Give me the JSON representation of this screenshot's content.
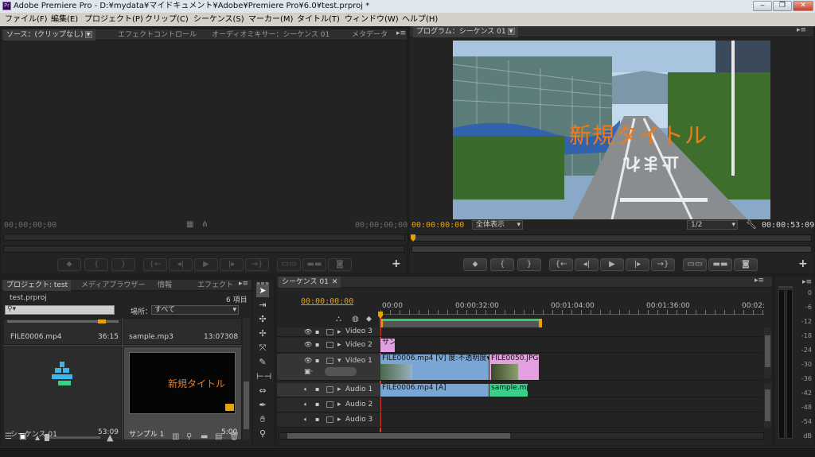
{
  "window": {
    "title": "Adobe Premiere Pro - D:¥mydata¥マイドキュメント¥Adobe¥Premiere Pro¥6.0¥test.prproj *",
    "app_icon": "Pr"
  },
  "menu": [
    "ファイル(F)",
    "編集(E)",
    "プロジェクト(P)",
    "クリップ(C)",
    "シーケンス(S)",
    "マーカー(M)",
    "タイトル(T)",
    "ウィンドウ(W)",
    "ヘルプ(H)"
  ],
  "source_panel": {
    "tabs": [
      "ソース：(クリップなし)",
      "エフェクトコントロール",
      "オーディオミキサー：シーケンス 01",
      "メタデータ"
    ],
    "tc_left": "00;00;00;00",
    "tc_right": "00;00;00;00"
  },
  "program_panel": {
    "tab": "プログラム：シーケンス 01",
    "tc_left": "00:00:00:00",
    "fit": "全体表示",
    "resolution": "1/2",
    "tc_right": "00:00:53:09",
    "overlay_title": "新規タイトル",
    "road_text": "止まれ"
  },
  "project_panel": {
    "tabs": [
      "プロジェクト: test",
      "メディアブラウザー",
      "情報",
      "エフェクト"
    ],
    "file": "test.prproj",
    "count": "6 項目",
    "location_label": "場所：",
    "location_value": "すべて",
    "items": [
      {
        "name": "FILE0006.mp4",
        "duration": "36:15"
      },
      {
        "name": "sample.mp3",
        "duration": "13:07308"
      },
      {
        "name": "シーケンス 01",
        "duration": "53:09"
      },
      {
        "name": "サンプル 1",
        "duration": "5:00",
        "thumb_text": "新規タイトル"
      }
    ]
  },
  "timeline": {
    "tab": "シーケンス 01",
    "tc": "00:00:00:00",
    "ruler": [
      "00:00",
      "00:00:32:00",
      "00:01:04:00",
      "00:01:36:00",
      "00:02:"
    ],
    "tracks": [
      {
        "name": "Video 3"
      },
      {
        "name": "Video 2",
        "clip": "サン"
      },
      {
        "name": "Video 1",
        "clip1": "FILE0006.mp4 [V] 度:不透明度▾",
        "clip2": "FILE0050.JPG"
      },
      {
        "name": "Audio 1",
        "clip1": "FILE0006.mp4 [A]",
        "clip2": "sample.mp"
      },
      {
        "name": "Audio 2"
      },
      {
        "name": "Audio 3"
      }
    ]
  },
  "meter": {
    "ticks": [
      "0",
      "-6",
      "-12",
      "-18",
      "-24",
      "-30",
      "-36",
      "-42",
      "-48",
      "-54",
      "dB"
    ]
  },
  "colors": {
    "accent": "#e6a300",
    "video_clip": "#7aa6d6",
    "image_clip": "#e2a0e0",
    "audio_clip": "#7aa6d6",
    "audio_clip2": "#3ad08a",
    "title_orange": "#f07a1a",
    "panel_bg": "#232323"
  }
}
